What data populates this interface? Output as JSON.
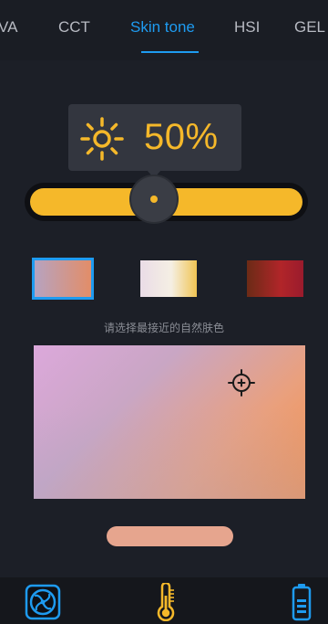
{
  "tabs": [
    {
      "label": "VA"
    },
    {
      "label": "CCT"
    },
    {
      "label": "Skin tone"
    },
    {
      "label": "HSI"
    },
    {
      "label": "GEL"
    }
  ],
  "active_tab": "Skin tone",
  "brightness": {
    "value_text": "50%",
    "level": 0.5,
    "icon": "sun-icon"
  },
  "presets": [
    {
      "name": "preset-1",
      "selected": true
    },
    {
      "name": "preset-2",
      "selected": false
    },
    {
      "name": "preset-3",
      "selected": false
    }
  ],
  "prompt_text": "请选择最接近的自然肤色",
  "selected_color": "#e6a58e",
  "colors": {
    "accent": "#1e9bf0",
    "brightness": "#f5b82a",
    "background": "#1c1f27"
  },
  "bottom_bar": {
    "icons": [
      "fan-icon",
      "thermometer-icon",
      "battery-icon"
    ]
  }
}
